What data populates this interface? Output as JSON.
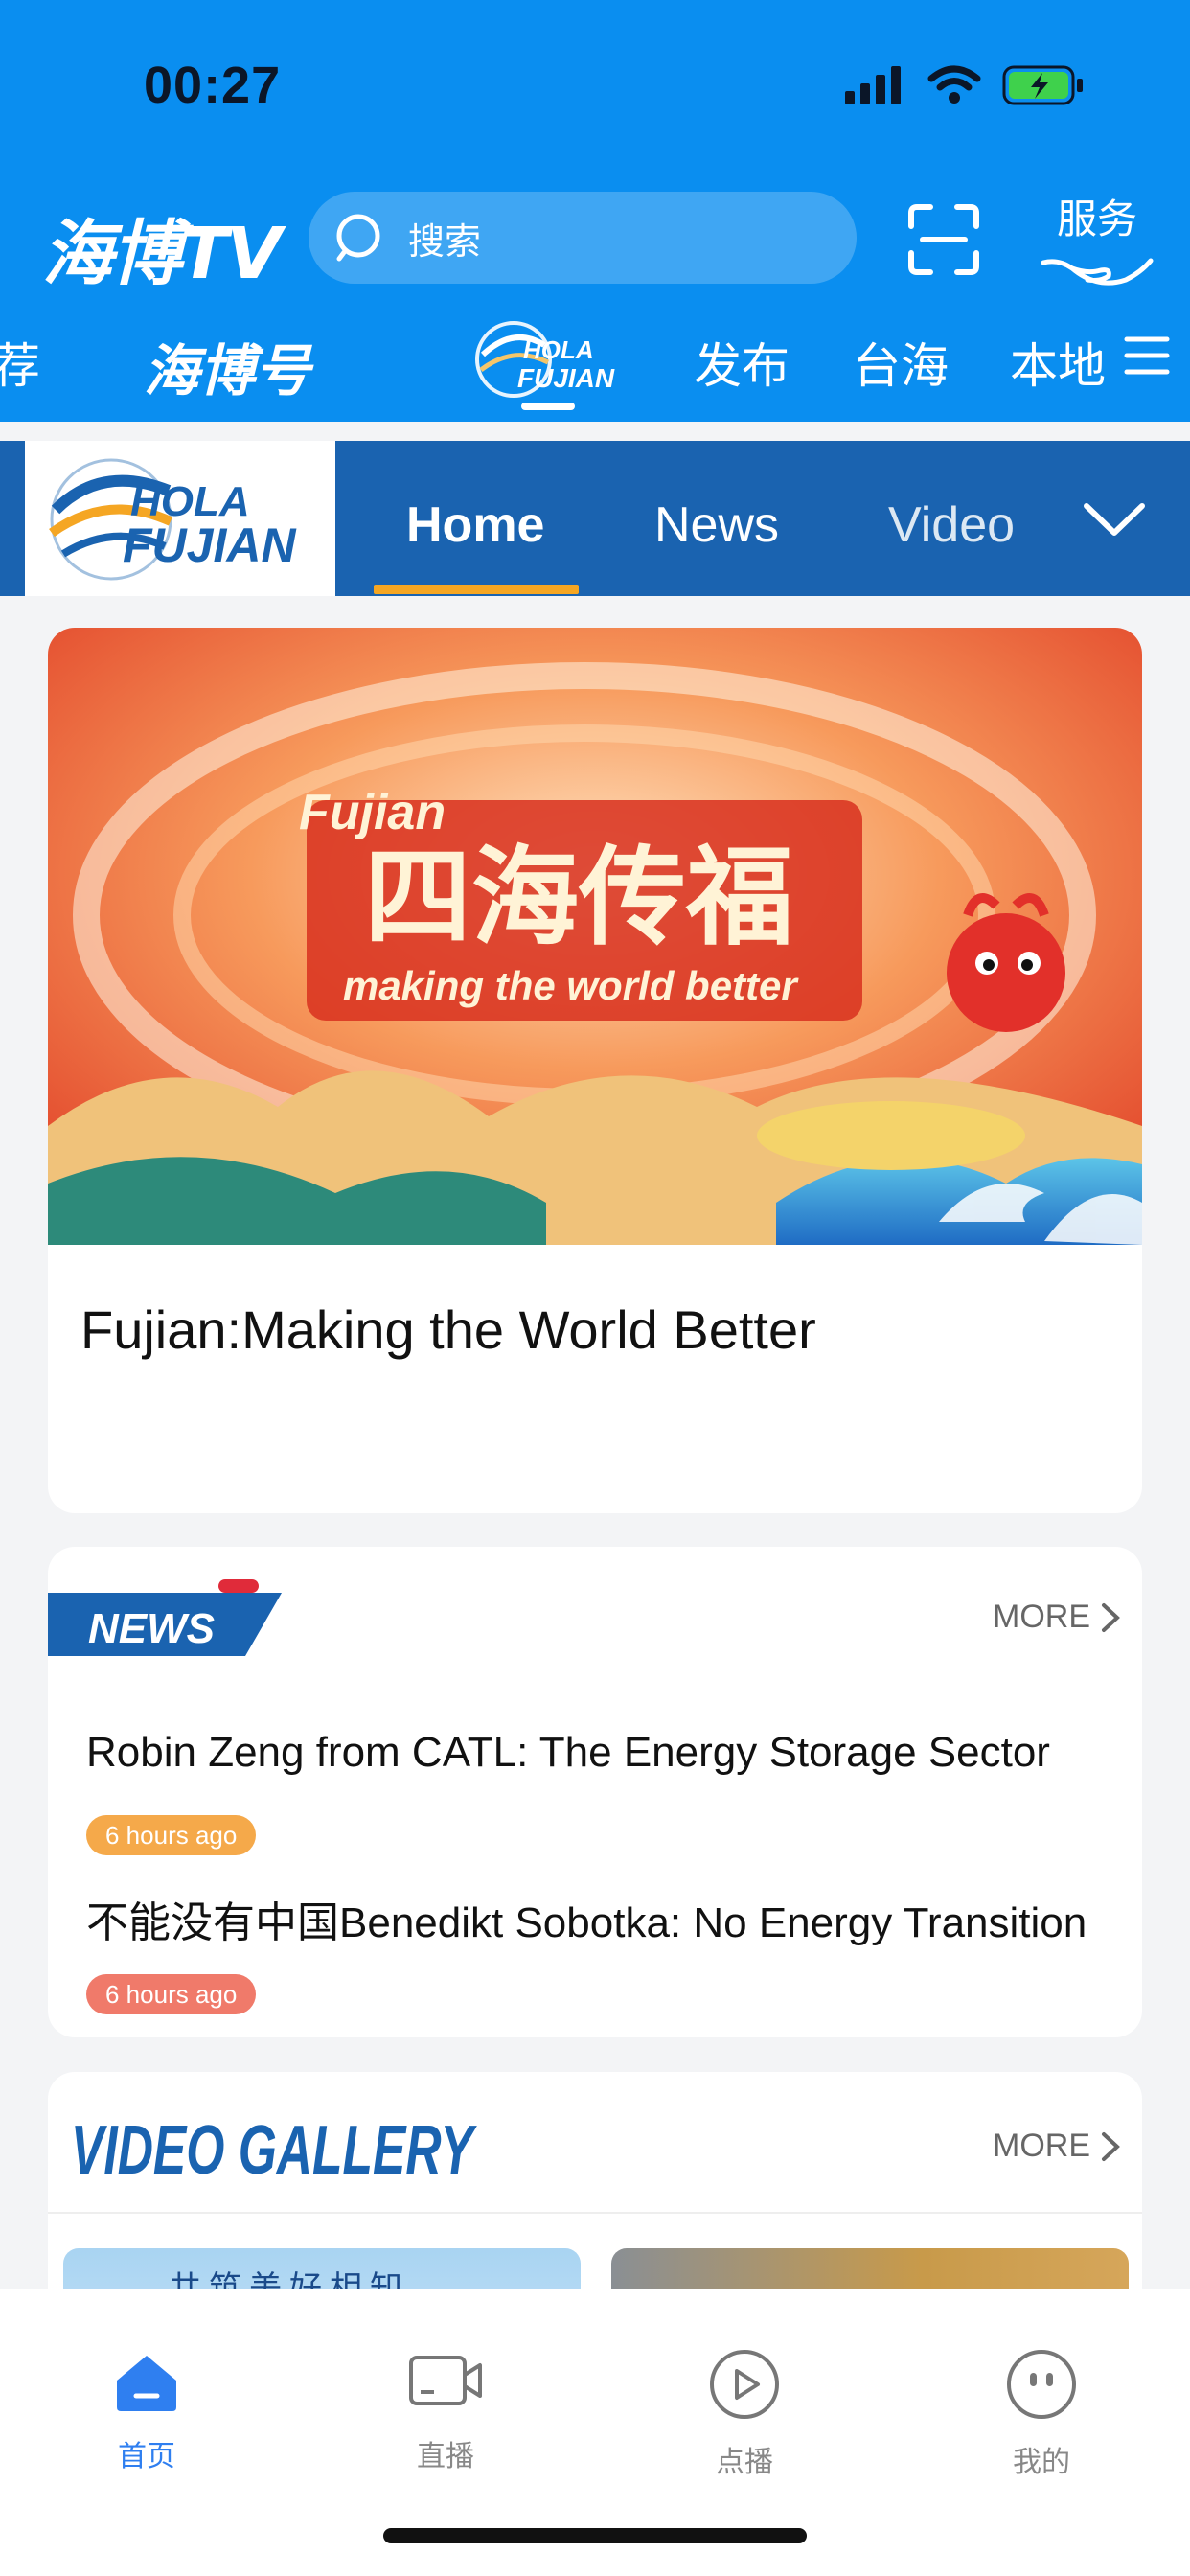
{
  "status_bar": {
    "time": "00:27"
  },
  "header": {
    "app_name": "海博TV",
    "search_placeholder": "搜索",
    "service_label": "服务"
  },
  "channels": [
    "荐",
    "海博号",
    "HOLA FUJIAN",
    "发布",
    "台海",
    "本地"
  ],
  "subnav": {
    "logo_text_top": "HOLA",
    "logo_text_bottom": "FUJIAN",
    "tabs": [
      "Home",
      "News",
      "Video"
    ]
  },
  "hero": {
    "banner_en_top": "Fujian",
    "banner_cn": "四海传福",
    "banner_en_sub": "making the world better",
    "title": "Fujian:Making the World Better"
  },
  "news_section": {
    "title": "NEWS",
    "more": "MORE",
    "items": [
      {
        "title": "Robin Zeng from CATL: The Energy Storage Sector",
        "time": "6 hours ago",
        "color": "#f5a94a"
      },
      {
        "title": "不能没有中国Benedikt Sobotka: No Energy Transition",
        "time": "6 hours ago",
        "color": "#f07a6a"
      }
    ]
  },
  "video_section": {
    "title": "VIDEO GALLERY",
    "more": "MORE",
    "thumb1_text": "共筑美好相知"
  },
  "tabbar": {
    "items": [
      {
        "label": "首页",
        "icon": "home-icon",
        "active": true
      },
      {
        "label": "直播",
        "icon": "live-camera-icon",
        "active": false
      },
      {
        "label": "点播",
        "icon": "play-circle-icon",
        "active": false
      },
      {
        "label": "我的",
        "icon": "profile-icon",
        "active": false
      }
    ]
  },
  "colors": {
    "accent": "#0a8ef0",
    "subnav": "#1a63b0",
    "orange": "#f5a623",
    "tab_active": "#2f7ff0"
  }
}
